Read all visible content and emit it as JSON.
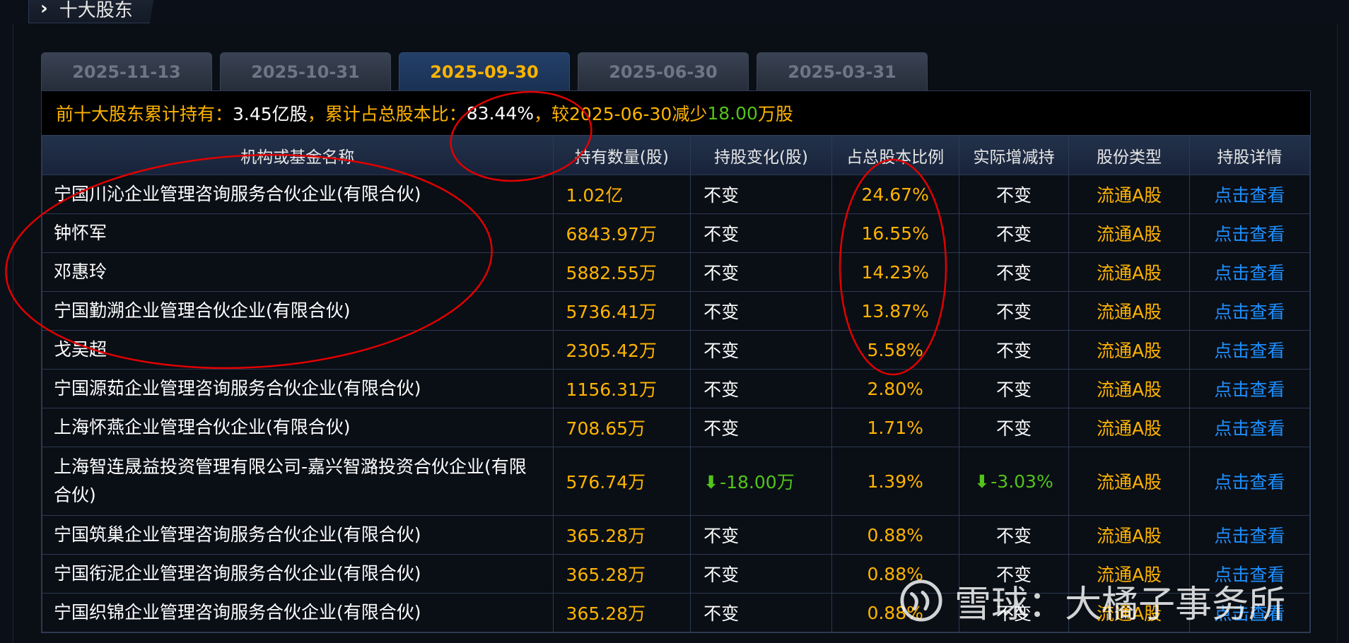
{
  "section": {
    "title": "十大股东"
  },
  "tabs": [
    "2025-11-13",
    "2025-10-31",
    "2025-09-30",
    "2025-06-30",
    "2025-03-31"
  ],
  "active_tab": "2025-09-30",
  "summary": {
    "label1": "前十大股东累计持有：",
    "total_shares": "3.45亿股",
    "label2": "，累计占总股本比：",
    "total_ratio": "83.44%",
    "label3": "，较2025-06-30减少",
    "decrease": "18.00",
    "unit": "万股"
  },
  "columns": [
    "机构或基金名称",
    "持有数量(股)",
    "持股变化(股)",
    "占总股本比例",
    "实际增减持",
    "股份类型",
    "持股详情"
  ],
  "rows": [
    {
      "name": "宁国川沁企业管理咨询服务合伙企业(有限合伙)",
      "qty": "1.02亿",
      "change": "不变",
      "ratio": "24.67%",
      "actual": "不变",
      "type": "流通A股",
      "detail": "点击查看"
    },
    {
      "name": "钟怀军",
      "qty": "6843.97万",
      "change": "不变",
      "ratio": "16.55%",
      "actual": "不变",
      "type": "流通A股",
      "detail": "点击查看"
    },
    {
      "name": "邓惠玲",
      "qty": "5882.55万",
      "change": "不变",
      "ratio": "14.23%",
      "actual": "不变",
      "type": "流通A股",
      "detail": "点击查看"
    },
    {
      "name": "宁国勤溯企业管理合伙企业(有限合伙)",
      "qty": "5736.41万",
      "change": "不变",
      "ratio": "13.87%",
      "actual": "不变",
      "type": "流通A股",
      "detail": "点击查看"
    },
    {
      "name": "戈吴超",
      "qty": "2305.42万",
      "change": "不变",
      "ratio": "5.58%",
      "actual": "不变",
      "type": "流通A股",
      "detail": "点击查看"
    },
    {
      "name": "宁国源茹企业管理咨询服务合伙企业(有限合伙)",
      "qty": "1156.31万",
      "change": "不变",
      "ratio": "2.80%",
      "actual": "不变",
      "type": "流通A股",
      "detail": "点击查看"
    },
    {
      "name": "上海怀燕企业管理合伙企业(有限合伙)",
      "qty": "708.65万",
      "change": "不变",
      "ratio": "1.71%",
      "actual": "不变",
      "type": "流通A股",
      "detail": "点击查看"
    },
    {
      "name": "上海智连晟益投资管理有限公司-嘉兴智潞投资合伙企业(有限合伙)",
      "qty": "576.74万",
      "change": "-18.00万",
      "change_down": true,
      "ratio": "1.39%",
      "actual": "-3.03%",
      "actual_down": true,
      "type": "流通A股",
      "detail": "点击查看"
    },
    {
      "name": "宁国筑巢企业管理咨询服务合伙企业(有限合伙)",
      "qty": "365.28万",
      "change": "不变",
      "ratio": "0.88%",
      "actual": "不变",
      "type": "流通A股",
      "detail": "点击查看"
    },
    {
      "name": "宁国衔泥企业管理咨询服务合伙企业(有限合伙)",
      "qty": "365.28万",
      "change": "不变",
      "ratio": "0.88%",
      "actual": "不变",
      "type": "流通A股",
      "detail": "点击查看"
    },
    {
      "name": "宁国织锦企业管理咨询服务合伙企业(有限合伙)",
      "qty": "365.28万",
      "change": "不变",
      "ratio": "0.88%",
      "actual": "不变",
      "type": "流通A股",
      "detail": "点击查看"
    }
  ],
  "watermark": {
    "text": "雪球：大橘子事务所",
    "icon": "xueqiu-logo-icon"
  },
  "colors": {
    "accent": "#ffb400",
    "link": "#1e90ff",
    "decrease": "#52c41a",
    "annotation": "#e00000"
  }
}
